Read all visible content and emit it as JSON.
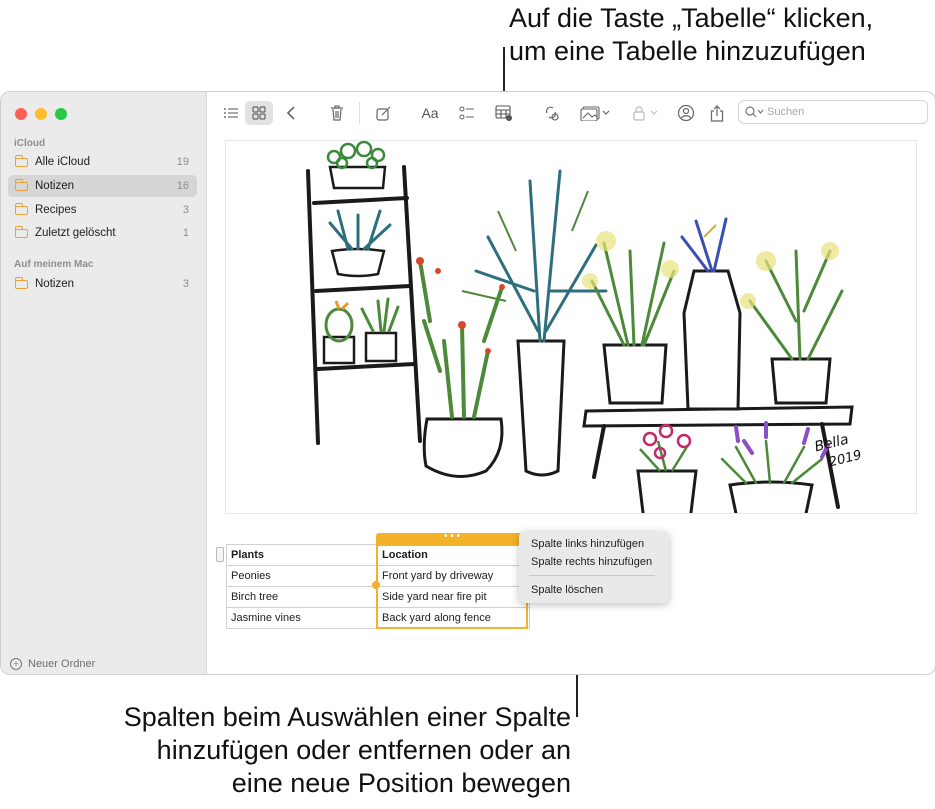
{
  "callouts": {
    "top_line1": "Auf die Taste „Tabelle“ klicken,",
    "top_line2": "um eine Tabelle hinzuzufügen",
    "bottom_line1": "Spalten beim Auswählen einer Spalte",
    "bottom_line2": "hinzufügen oder entfernen oder an",
    "bottom_line3": "eine neue Position bewegen"
  },
  "window_controls": {
    "close_color": "#ff5f57",
    "minimize_color": "#febc2e",
    "zoom_color": "#28c840"
  },
  "sidebar": {
    "icloud_title": "iCloud",
    "icloud_folders": [
      {
        "label": "Alle iCloud",
        "count": "19"
      },
      {
        "label": "Notizen",
        "count": "16",
        "selected": true
      },
      {
        "label": "Recipes",
        "count": "3"
      },
      {
        "label": "Zuletzt gelöscht",
        "count": "1"
      }
    ],
    "mac_title": "Auf meinem Mac",
    "mac_folders": [
      {
        "label": "Notizen",
        "count": "3"
      }
    ],
    "new_folder": "Neuer Ordner"
  },
  "toolbar": {
    "icons": [
      "list-view-icon",
      "gallery-view-icon",
      "back-icon",
      "delete-icon",
      "compose-icon",
      "format-icon",
      "checklist-icon",
      "table-icon",
      "collaborate-icon",
      "media-icon",
      "lock-icon",
      "share-user-icon",
      "share-icon"
    ],
    "format_label": "Aa",
    "search_placeholder": "Suchen"
  },
  "drawing": {
    "signature_line1": "Bella",
    "signature_line2": "2019"
  },
  "table": {
    "headers": [
      "Plants",
      "Location"
    ],
    "rows": [
      [
        "Peonies",
        "Front yard by driveway"
      ],
      [
        "Birch tree",
        "Side yard near fire pit"
      ],
      [
        "Jasmine vines",
        "Back yard along fence"
      ]
    ],
    "handle_dots": "• • •"
  },
  "context_menu": {
    "items": [
      "Spalte links hinzufügen",
      "Spalte rechts hinzufügen",
      "Spalte löschen"
    ]
  },
  "colors": {
    "accent": "#f3b22a",
    "folder": "#e9a23b"
  }
}
